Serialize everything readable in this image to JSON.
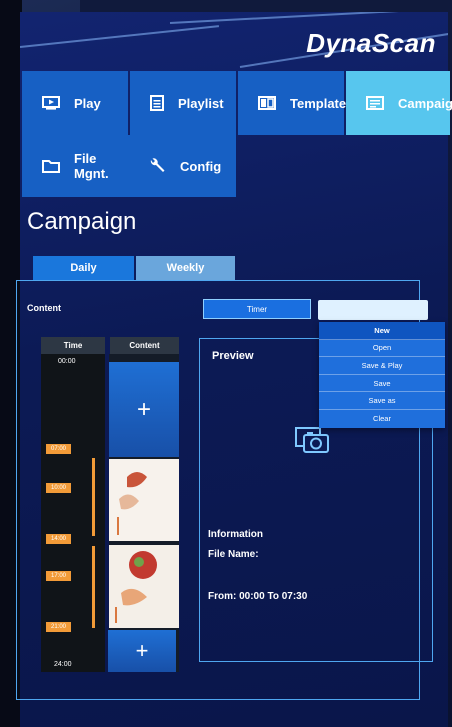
{
  "brand": "DynaScan",
  "nav": {
    "items": [
      {
        "label": "Play",
        "icon": "play-icon"
      },
      {
        "label": "Playlist",
        "icon": "list-icon"
      },
      {
        "label": "Template",
        "icon": "template-icon"
      },
      {
        "label": "Campaign",
        "icon": "campaign-icon",
        "active": true
      },
      {
        "label": "File Mgnt.",
        "icon": "folder-icon"
      },
      {
        "label": "Config",
        "icon": "wrench-icon"
      }
    ]
  },
  "page": {
    "title": "Campaign"
  },
  "tabs": [
    {
      "label": "Daily",
      "active": true
    },
    {
      "label": "Weekly",
      "active": false
    }
  ],
  "content_label": "Content",
  "timer_label": "Timer",
  "menu": {
    "items": [
      "New",
      "Open",
      "Save & Play",
      "Save",
      "Save as",
      "Clear"
    ]
  },
  "timeline": {
    "time_header": "Time",
    "content_header": "Content",
    "start": "00:00",
    "end": "24:00",
    "markers": [
      "07:00",
      "10:00",
      "14:00",
      "17:00",
      "21:00"
    ],
    "add_symbol": "+"
  },
  "preview": {
    "title": "Preview",
    "info_heading": "Information",
    "file_name_label": "File Name:",
    "range": "From: 00:00 To 07:30"
  },
  "colors": {
    "tile": "#1760c4",
    "tile_active": "#57c6ee",
    "accent_orange": "#f29b38",
    "border_blue": "#4fa7f0"
  }
}
